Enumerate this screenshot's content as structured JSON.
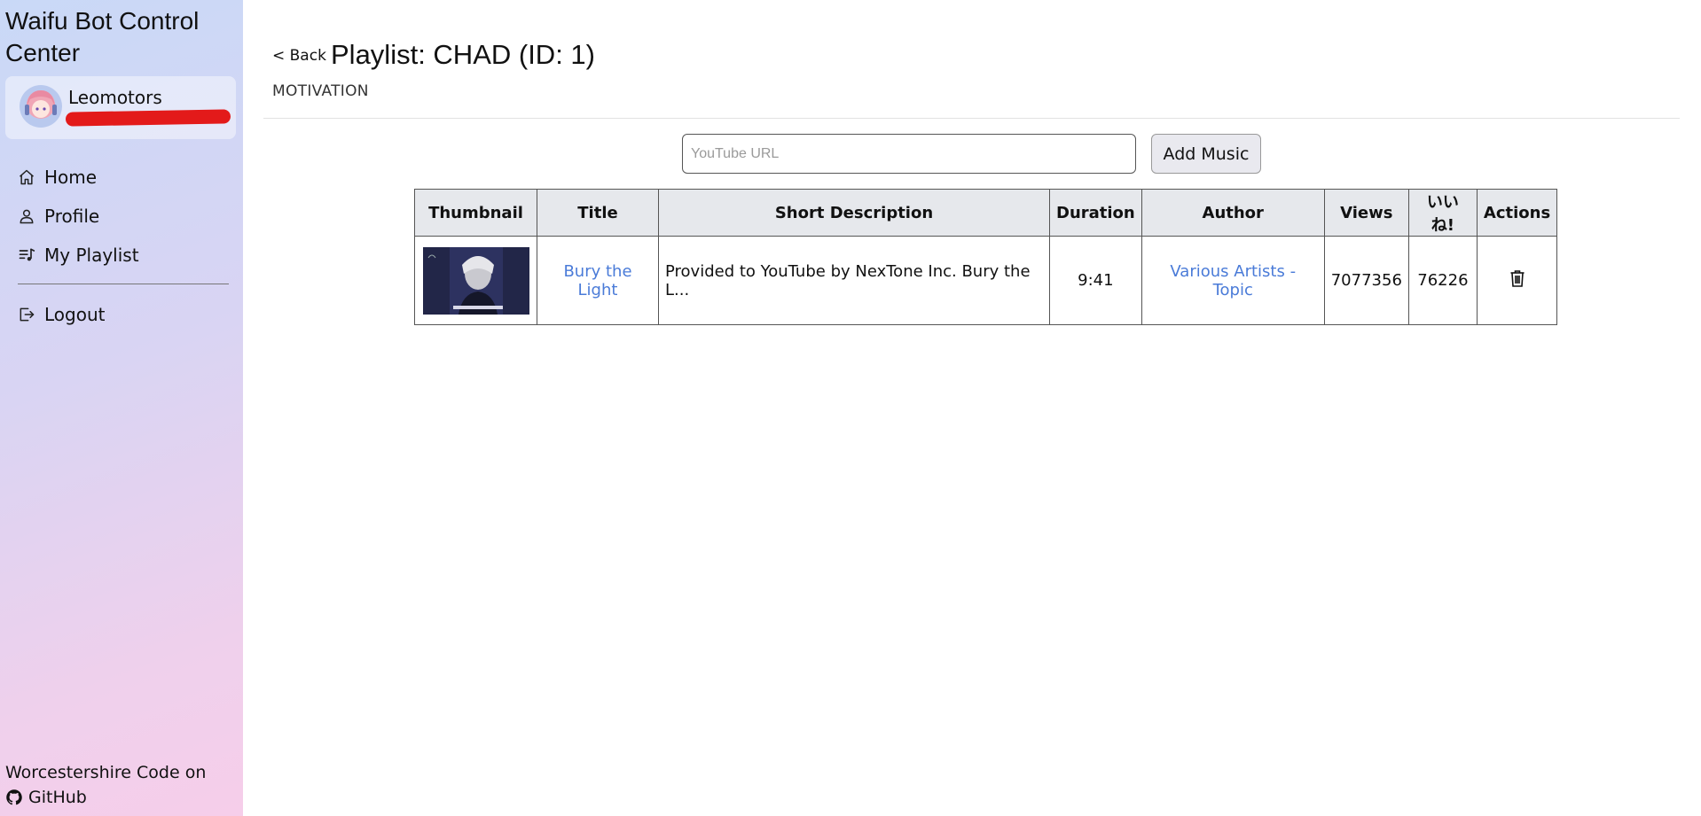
{
  "app": {
    "title": "Waifu Bot Control Center"
  },
  "user": {
    "name": "Leomotors"
  },
  "nav": {
    "home": "Home",
    "profile": "Profile",
    "playlist": "My Playlist",
    "logout": "Logout"
  },
  "footer": {
    "credit": "Worcestershire Code on",
    "github": "GitHub"
  },
  "page": {
    "back": "< Back",
    "title": "Playlist: CHAD (ID: 1)",
    "subtitle": "MOTIVATION"
  },
  "add_music": {
    "placeholder": "YouTube URL",
    "button": "Add Music"
  },
  "table": {
    "headers": [
      "Thumbnail",
      "Title",
      "Short Description",
      "Duration",
      "Author",
      "Views",
      "いいね!",
      "Actions"
    ],
    "rows": [
      {
        "title": "Bury the Light",
        "description": "Provided to YouTube by NexTone Inc. Bury the L...",
        "duration": "9:41",
        "author": "Various Artists - Topic",
        "views": "7077356",
        "likes": "76226"
      }
    ]
  },
  "colors": {
    "link": "#4a7bd8",
    "redaction": "#e31a1a"
  },
  "icons": [
    "home-icon",
    "user-icon",
    "playlist-icon",
    "logout-icon",
    "github-icon",
    "trash-icon"
  ]
}
